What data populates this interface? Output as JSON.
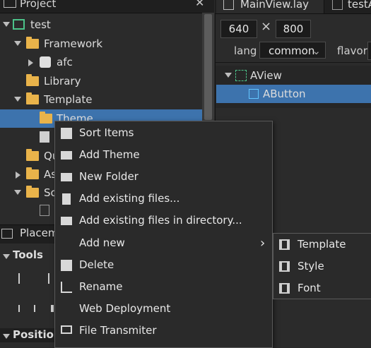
{
  "project_panel": {
    "title": "Project",
    "close_glyph": "✕",
    "tree": [
      {
        "label": "test",
        "icon": "project-icon"
      },
      {
        "label": "Framework",
        "icon": "folder-icon"
      },
      {
        "label": "afc",
        "icon": "puzzle-icon"
      },
      {
        "label": "Library",
        "icon": "folder-icon"
      },
      {
        "label": "Template",
        "icon": "folder-icon"
      },
      {
        "label": "Theme",
        "icon": "folder-icon"
      },
      {
        "label": "Qu",
        "icon": "folder-icon"
      },
      {
        "label": "As",
        "icon": "folder-icon"
      },
      {
        "label": "Sc",
        "icon": "folder-icon"
      }
    ]
  },
  "placement_panel": {
    "title": "Placem"
  },
  "tools_panel": {
    "title": "Tools"
  },
  "position_panel": {
    "title": "Position"
  },
  "editor": {
    "tabs": [
      {
        "label": "MainView.lay"
      },
      {
        "label": "testA"
      }
    ],
    "width_value": "640",
    "times_glyph": "×",
    "height_value": "800",
    "lang_label": "lang",
    "lang_value": "common",
    "flavor_label": "flavor",
    "scene": [
      {
        "label": "AView",
        "icon": "view-icon"
      },
      {
        "label": "AButton",
        "icon": "button-icon"
      }
    ]
  },
  "context_menu": {
    "items": [
      {
        "label": "Sort Items",
        "icon": "sort-icon"
      },
      {
        "label": "Add Theme",
        "icon": "folder-icon"
      },
      {
        "label": "New Folder",
        "icon": "folder-icon"
      },
      {
        "label": "Add existing files...",
        "icon": "file-icon"
      },
      {
        "label": "Add existing files in directory...",
        "icon": "folder-icon"
      },
      {
        "label": "Add new",
        "icon": "",
        "submenu_arrow": "›"
      },
      {
        "label": "Delete",
        "icon": "delete-icon"
      },
      {
        "label": "Rename",
        "icon": "rename-icon"
      },
      {
        "label": "Web Deployment",
        "icon": ""
      },
      {
        "label": "File Transmiter",
        "icon": "monitor-icon"
      }
    ],
    "submenu": [
      {
        "label": "Template",
        "icon": "film-icon"
      },
      {
        "label": "Style",
        "icon": "film-icon"
      },
      {
        "label": "Font",
        "icon": "film-icon"
      }
    ]
  },
  "colors": {
    "selection": "#3d73ad",
    "folder": "#e9b34a",
    "background": "#2b2b2b"
  }
}
